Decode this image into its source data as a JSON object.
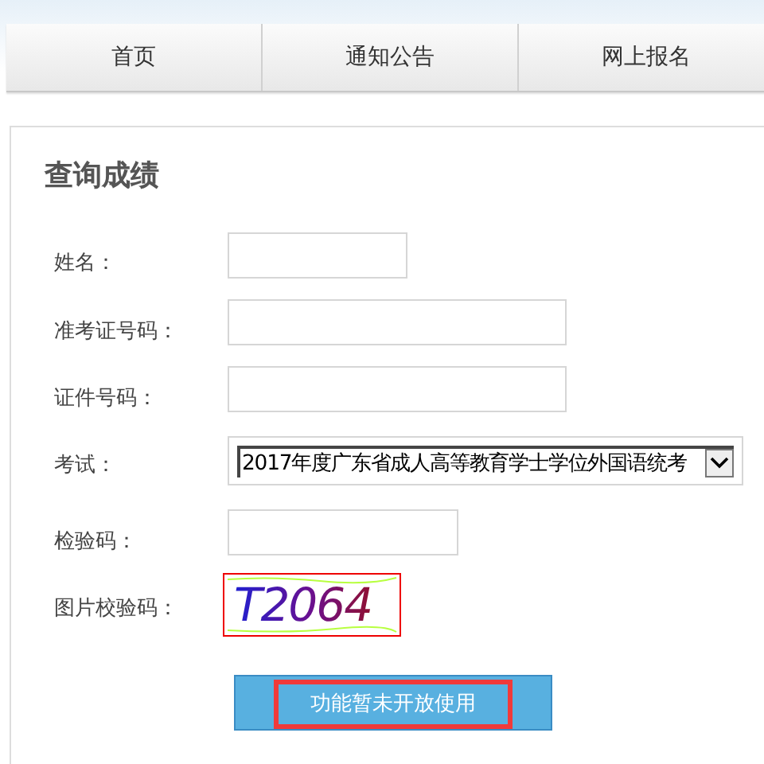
{
  "nav": {
    "tabs": [
      {
        "label": "首页",
        "selected": false
      },
      {
        "label": "通知公告",
        "selected": false
      },
      {
        "label": "网上报名",
        "selected": false
      }
    ]
  },
  "panel": {
    "title": "查询成绩",
    "fields": [
      {
        "kind": "text",
        "label": "姓名："
      },
      {
        "kind": "text",
        "label": "准考证号码："
      },
      {
        "kind": "text",
        "label": "证件号码："
      },
      {
        "kind": "select",
        "label": "考试：",
        "value": "2017年度广东省成人高等教育学士学位外国语统考"
      },
      {
        "kind": "text",
        "label": "检验码："
      },
      {
        "kind": "captcha",
        "label": "图片校验码：",
        "value": "T2064"
      }
    ],
    "button": {
      "label": "功能暂未开放使用",
      "highlighted": true
    }
  }
}
